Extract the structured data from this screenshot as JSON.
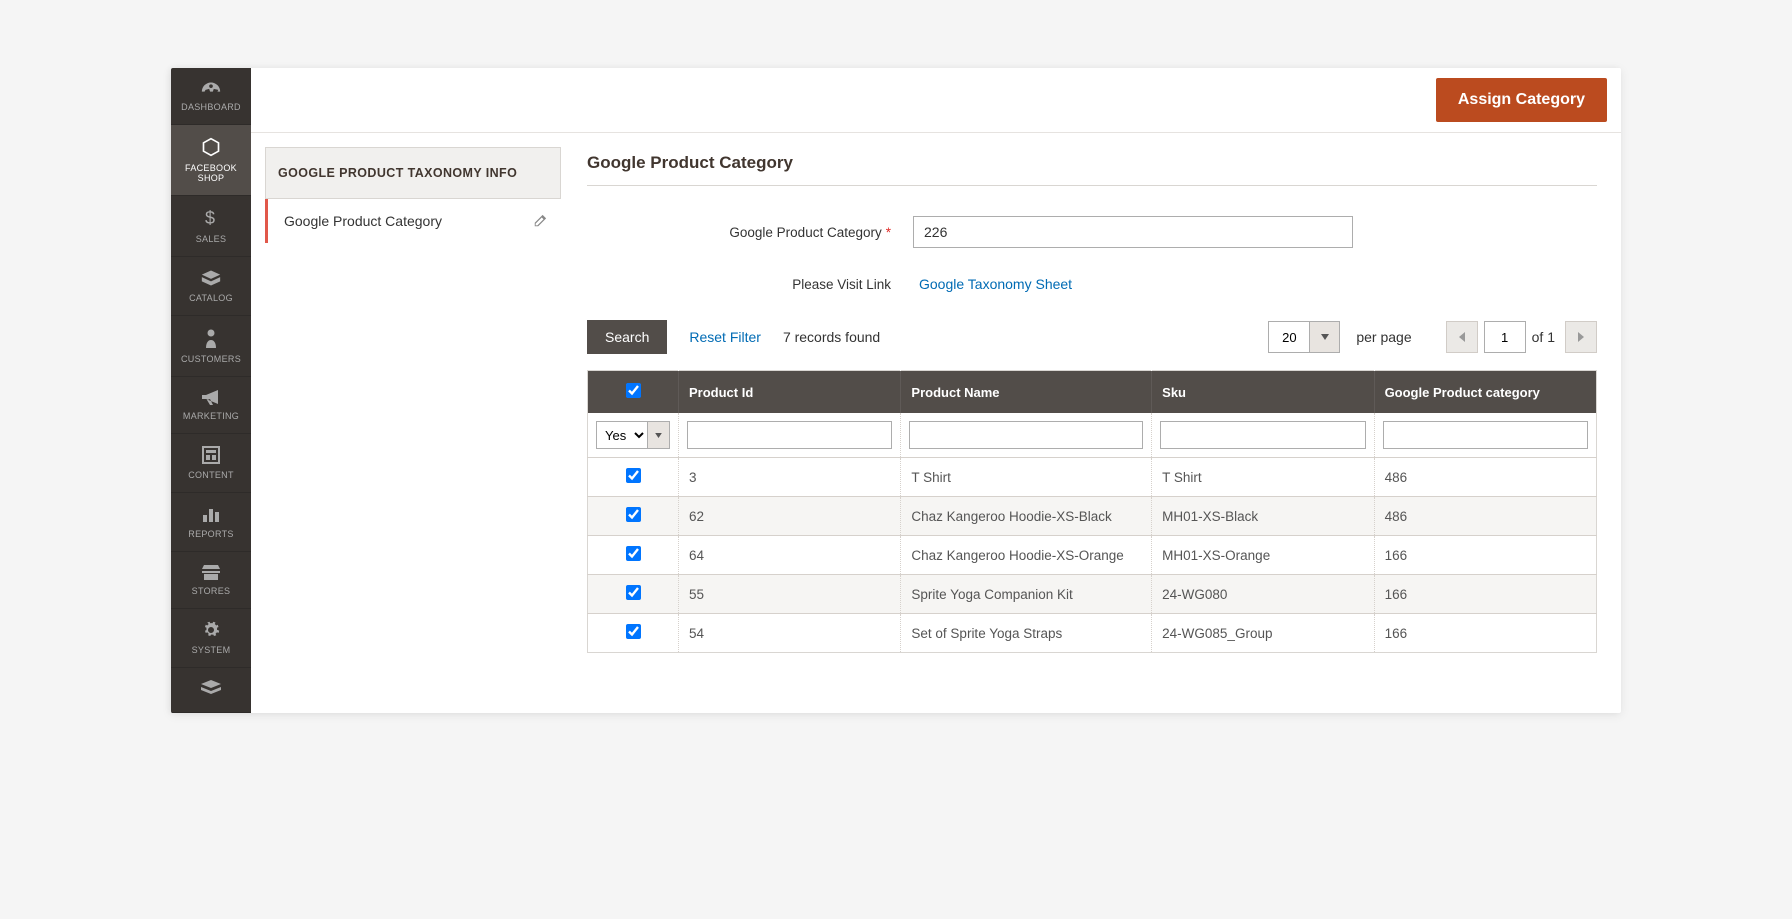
{
  "header": {
    "assign_button": "Assign Category"
  },
  "sidebar": {
    "items": [
      {
        "label": "DASHBOARD"
      },
      {
        "label": "FACEBOOK SHOP"
      },
      {
        "label": "SALES"
      },
      {
        "label": "CATALOG"
      },
      {
        "label": "CUSTOMERS"
      },
      {
        "label": "MARKETING"
      },
      {
        "label": "CONTENT"
      },
      {
        "label": "REPORTS"
      },
      {
        "label": "STORES"
      },
      {
        "label": "SYSTEM"
      }
    ]
  },
  "side_panel": {
    "header": "GOOGLE PRODUCT TAXONOMY INFO",
    "item": "Google Product Category"
  },
  "section": {
    "title": "Google Product Category",
    "field_label": "Google Product Category",
    "field_value": "226",
    "visit_label": "Please Visit Link",
    "visit_link": "Google Taxonomy Sheet"
  },
  "grid": {
    "search": "Search",
    "reset": "Reset Filter",
    "records": "7 records found",
    "per_page_value": "20",
    "per_page_label": "per page",
    "page_value": "1",
    "of_label": "of 1",
    "filter_select": "Yes",
    "columns": [
      "",
      "Product Id",
      "Product Name",
      "Sku",
      "Google Product category"
    ],
    "rows": [
      {
        "checked": true,
        "id": "3",
        "name": "T Shirt",
        "sku": "T Shirt",
        "cat": "486"
      },
      {
        "checked": true,
        "id": "62",
        "name": "Chaz Kangeroo Hoodie-XS-Black",
        "sku": "MH01-XS-Black",
        "cat": "486"
      },
      {
        "checked": true,
        "id": "64",
        "name": "Chaz Kangeroo Hoodie-XS-Orange",
        "sku": "MH01-XS-Orange",
        "cat": "166"
      },
      {
        "checked": true,
        "id": "55",
        "name": "Sprite Yoga Companion Kit",
        "sku": "24-WG080",
        "cat": "166"
      },
      {
        "checked": true,
        "id": "54",
        "name": "Set of Sprite Yoga Straps",
        "sku": "24-WG085_Group",
        "cat": "166"
      }
    ]
  }
}
